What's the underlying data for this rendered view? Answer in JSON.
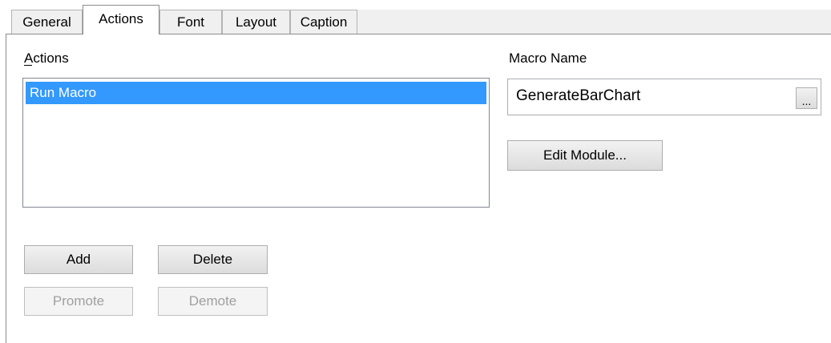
{
  "tabs": [
    {
      "label": "General",
      "active": false
    },
    {
      "label": "Actions",
      "active": true
    },
    {
      "label": "Font",
      "active": false
    },
    {
      "label": "Layout",
      "active": false
    },
    {
      "label": "Caption",
      "active": false
    }
  ],
  "actions": {
    "label": "Actions",
    "items": [
      "Run Macro"
    ],
    "selected": "Run Macro"
  },
  "macro": {
    "label": "Macro Name",
    "value": "GenerateBarChart",
    "browse_label": "..."
  },
  "buttons": {
    "edit_module": "Edit Module...",
    "add": "Add",
    "delete": "Delete",
    "promote": "Promote",
    "demote": "Demote"
  },
  "colors": {
    "selection": "#3399ff",
    "disabled_text": "#a0a0a0"
  }
}
